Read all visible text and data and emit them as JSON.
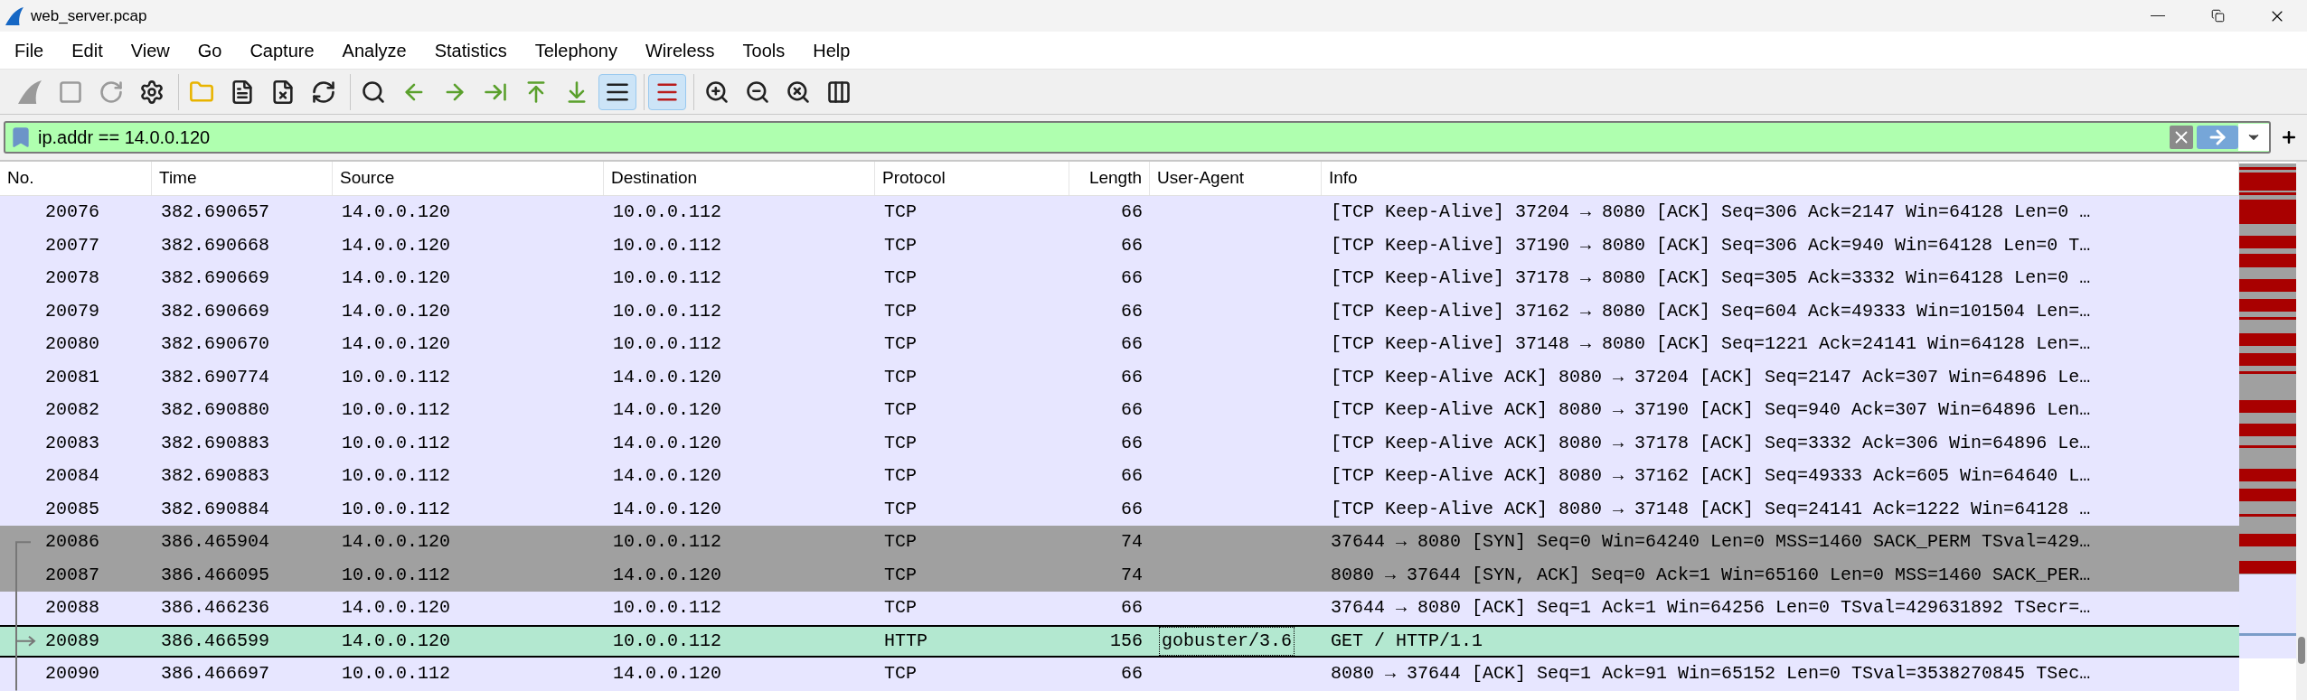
{
  "window": {
    "title": "web_server.pcap"
  },
  "menu": [
    "File",
    "Edit",
    "View",
    "Go",
    "Capture",
    "Analyze",
    "Statistics",
    "Telephony",
    "Wireless",
    "Tools",
    "Help"
  ],
  "toolbar": [
    [
      {
        "disabled": true,
        "on": false
      },
      {
        "disabled": true,
        "on": false
      },
      {
        "disabled": true,
        "on": false
      },
      {
        "disabled": false,
        "on": false
      }
    ],
    [
      {
        "disabled": false,
        "on": false
      },
      {
        "disabled": false,
        "on": false
      },
      {
        "disabled": false,
        "on": false
      },
      {
        "disabled": false,
        "on": false
      }
    ],
    [
      {
        "disabled": false,
        "on": false
      },
      {
        "disabled": false,
        "on": false
      },
      {
        "disabled": false,
        "on": false
      },
      {
        "disabled": false,
        "on": false
      },
      {
        "disabled": false,
        "on": false
      },
      {
        "disabled": false,
        "on": false
      },
      {
        "disabled": false,
        "on": true
      }
    ],
    [
      {
        "disabled": false,
        "on": true
      }
    ],
    [
      {
        "disabled": false,
        "on": false
      },
      {
        "disabled": false,
        "on": false
      },
      {
        "disabled": false,
        "on": false
      },
      {
        "disabled": false,
        "on": false
      }
    ]
  ],
  "filter": {
    "value": "ip.addr == 14.0.0.120",
    "valid": true
  },
  "table": {
    "columns": [
      "No.",
      "Time",
      "Source",
      "Destination",
      "Protocol",
      "Length",
      "User-Agent",
      "Info"
    ],
    "rows": [
      {
        "no": "20076",
        "time": "382.690657",
        "source": "14.0.0.120",
        "destination": "10.0.0.112",
        "protocol": "TCP",
        "length": "66",
        "info": "[TCP Keep-Alive] 37204 → 8080 [ACK] Seq=306 Ack=2147 Win=64128 Len=0 …",
        "color": "#e7e6ff",
        "selected": false
      },
      {
        "no": "20077",
        "time": "382.690668",
        "source": "14.0.0.120",
        "destination": "10.0.0.112",
        "protocol": "TCP",
        "length": "66",
        "info": "[TCP Keep-Alive] 37190 → 8080 [ACK] Seq=306 Ack=940 Win=64128 Len=0 T…",
        "color": "#e7e6ff",
        "selected": false
      },
      {
        "no": "20078",
        "time": "382.690669",
        "source": "14.0.0.120",
        "destination": "10.0.0.112",
        "protocol": "TCP",
        "length": "66",
        "info": "[TCP Keep-Alive] 37178 → 8080 [ACK] Seq=305 Ack=3332 Win=64128 Len=0 …",
        "color": "#e7e6ff",
        "selected": false
      },
      {
        "no": "20079",
        "time": "382.690669",
        "source": "14.0.0.120",
        "destination": "10.0.0.112",
        "protocol": "TCP",
        "length": "66",
        "info": "[TCP Keep-Alive] 37162 → 8080 [ACK] Seq=604 Ack=49333 Win=101504 Len=…",
        "color": "#e7e6ff",
        "selected": false
      },
      {
        "no": "20080",
        "time": "382.690670",
        "source": "14.0.0.120",
        "destination": "10.0.0.112",
        "protocol": "TCP",
        "length": "66",
        "info": "[TCP Keep-Alive] 37148 → 8080 [ACK] Seq=1221 Ack=24141 Win=64128 Len=…",
        "color": "#e7e6ff",
        "selected": false
      },
      {
        "no": "20081",
        "time": "382.690774",
        "source": "10.0.0.112",
        "destination": "14.0.0.120",
        "protocol": "TCP",
        "length": "66",
        "info": "[TCP Keep-Alive ACK] 8080 → 37204 [ACK] Seq=2147 Ack=307 Win=64896 Le…",
        "color": "#e7e6ff",
        "selected": false
      },
      {
        "no": "20082",
        "time": "382.690880",
        "source": "10.0.0.112",
        "destination": "14.0.0.120",
        "protocol": "TCP",
        "length": "66",
        "info": "[TCP Keep-Alive ACK] 8080 → 37190 [ACK] Seq=940 Ack=307 Win=64896 Len…",
        "color": "#e7e6ff",
        "selected": false
      },
      {
        "no": "20083",
        "time": "382.690883",
        "source": "10.0.0.112",
        "destination": "14.0.0.120",
        "protocol": "TCP",
        "length": "66",
        "info": "[TCP Keep-Alive ACK] 8080 → 37178 [ACK] Seq=3332 Ack=306 Win=64896 Le…",
        "color": "#e7e6ff",
        "selected": false
      },
      {
        "no": "20084",
        "time": "382.690883",
        "source": "10.0.0.112",
        "destination": "14.0.0.120",
        "protocol": "TCP",
        "length": "66",
        "info": "[TCP Keep-Alive ACK] 8080 → 37162 [ACK] Seq=49333 Ack=605 Win=64640 L…",
        "color": "#e7e6ff",
        "selected": false
      },
      {
        "no": "20085",
        "time": "382.690884",
        "source": "10.0.0.112",
        "destination": "14.0.0.120",
        "protocol": "TCP",
        "length": "66",
        "info": "[TCP Keep-Alive ACK] 8080 → 37148 [ACK] Seq=24141 Ack=1222 Win=64128 …",
        "color": "#e7e6ff",
        "selected": false
      },
      {
        "no": "20086",
        "time": "386.465904",
        "source": "14.0.0.120",
        "destination": "10.0.0.112",
        "protocol": "TCP",
        "length": "74",
        "info": "37644 → 8080 [SYN] Seq=0 Win=64240 Len=0 MSS=1460 SACK_PERM TSval=429…",
        "color": "#a0a0a0",
        "selected": false
      },
      {
        "no": "20087",
        "time": "386.466095",
        "source": "10.0.0.112",
        "destination": "14.0.0.120",
        "protocol": "TCP",
        "length": "74",
        "info": "8080 → 37644 [SYN, ACK] Seq=0 Ack=1 Win=65160 Len=0 MSS=1460 SACK_PER…",
        "color": "#a0a0a0",
        "selected": false
      },
      {
        "no": "20088",
        "time": "386.466236",
        "source": "14.0.0.120",
        "destination": "10.0.0.112",
        "protocol": "TCP",
        "length": "66",
        "info": "37644 → 8080 [ACK] Seq=1 Ack=1 Win=64256 Len=0 TSval=429631892 TSecr=…",
        "color": "#e7e6ff",
        "selected": false
      },
      {
        "no": "20089",
        "time": "386.466599",
        "source": "14.0.0.120",
        "destination": "10.0.0.112",
        "protocol": "HTTP",
        "length": "156",
        "user_agent": "gobuster/3.6",
        "info": "GET / HTTP/1.1",
        "color": "#b3e8d0",
        "selected": true
      },
      {
        "no": "20090",
        "time": "386.466697",
        "source": "10.0.0.112",
        "destination": "14.0.0.120",
        "protocol": "TCP",
        "length": "66",
        "info": "8080 → 37644 [ACK] Seq=1 Ack=91 Win=65152 Len=0 TSval=3538270845 TSec…",
        "color": "#e7e6ff",
        "selected": false
      }
    ]
  }
}
